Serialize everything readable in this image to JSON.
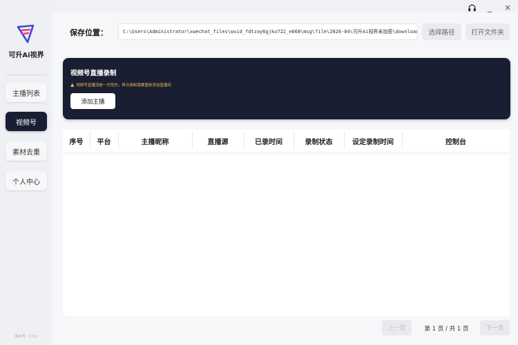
{
  "app": {
    "brand": "可升Ai视界",
    "version": "版本号：1.0.0"
  },
  "window": {
    "minimize": "_",
    "close": "×"
  },
  "nav": [
    {
      "label": "主播列表",
      "active": false
    },
    {
      "label": "视频号",
      "active": true
    },
    {
      "label": "素材去重",
      "active": false
    },
    {
      "label": "个人中心",
      "active": false
    }
  ],
  "toolbar": {
    "save_label": "保存位置：",
    "path_value": "C:\\Users\\Administrator\\xwechat_files\\wxid_fdtzay6gjko722_e668\\msg\\file\\2026-04\\可升Ai视界未加密\\downloads",
    "choose_path": "选择路径",
    "open_folder": "打开文件夹"
  },
  "card": {
    "title": "视频号直播录制",
    "warning": "视频号直播流是一次性的，再次录制需要重新添加直播间",
    "add_button": "添加主播"
  },
  "table": {
    "columns": [
      "序号",
      "平台",
      "主播昵称",
      "直播源",
      "已录时间",
      "录制状态",
      "设定录制时间",
      "控制台"
    ],
    "rows": []
  },
  "pager": {
    "prev": "上一页",
    "info": "第 1 页 / 共 1 页",
    "next": "下一页"
  },
  "colors": {
    "accent_dark": "#1a1e33",
    "warning": "#e8b84a",
    "background": "#f0f1f4"
  },
  "icons": {
    "support": "headset-icon",
    "logo": "app-logo-icon",
    "warning": "warning-icon"
  }
}
